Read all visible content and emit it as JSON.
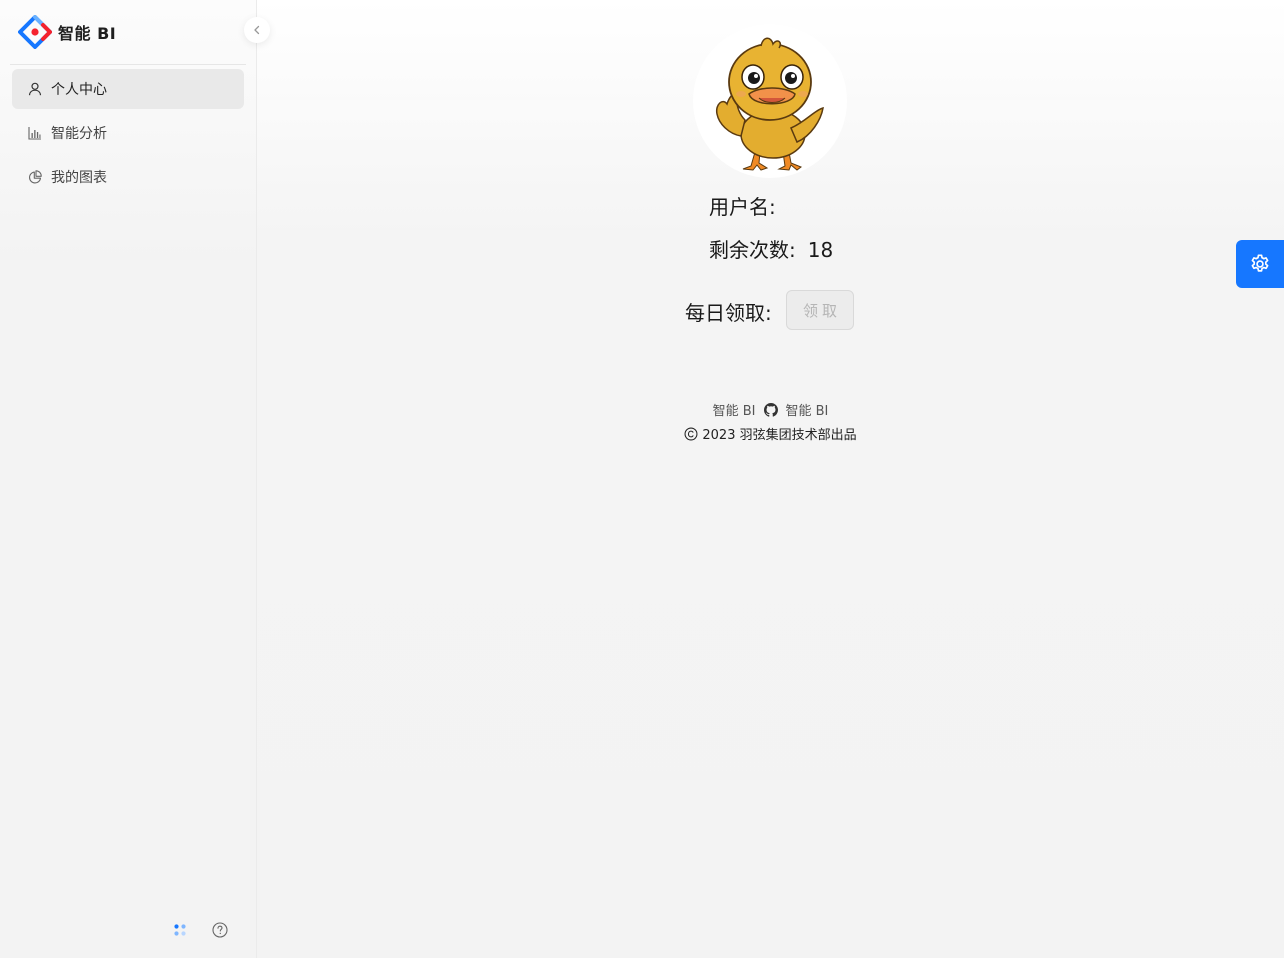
{
  "app": {
    "title": "智能 BI"
  },
  "sidebar": {
    "items": [
      {
        "label": "个人中心",
        "icon": "user-icon",
        "active": true
      },
      {
        "label": "智能分析",
        "icon": "bar-chart-icon",
        "active": false
      },
      {
        "label": "我的图表",
        "icon": "pie-chart-icon",
        "active": false
      }
    ],
    "footer_icons": [
      "apps-icon",
      "question-circle-icon"
    ]
  },
  "profile": {
    "username_label": "用户名:",
    "username_value": "",
    "remaining_label": "剩余次数:",
    "remaining_value": "18",
    "daily_label": "每日领取:",
    "claim_button": "领取",
    "claim_disabled": true
  },
  "footer": {
    "link1": "智能 BI",
    "link2": "智能 BI",
    "copyright": "2023 羽弦集团技术部出品"
  },
  "colors": {
    "primary": "#1677ff",
    "logo_blue": "#1677ff",
    "logo_red": "#f5222d"
  }
}
